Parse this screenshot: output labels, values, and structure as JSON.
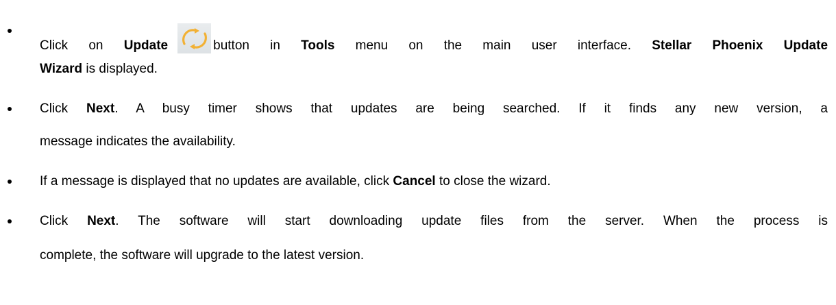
{
  "icons": {
    "update_icon": "update-circular-arrows-icon",
    "bullet_icon": "bullet-dot-icon"
  },
  "colors": {
    "text": "#000000",
    "icon_arrow": "#f2b134",
    "icon_background": "#e3e7ea"
  },
  "steps": [
    {
      "line1": {
        "pre": "Click on ",
        "bold1": "Update",
        "post1": "button in ",
        "bold2": "Tools",
        "post2": " menu on the main user interface. ",
        "bold3": "Stellar Phoenix Update"
      },
      "line2": {
        "bold": "Wizard",
        "post": " is displayed."
      }
    },
    {
      "line1": {
        "pre": "Click ",
        "bold": "Next",
        "post": ". A busy timer shows that updates are being searched. If it finds any new version, a"
      },
      "line2": {
        "text": "message indicates the availability."
      }
    },
    {
      "line1": {
        "pre": "If a message is displayed that no updates are available, click ",
        "bold": "Cancel",
        "post": " to close the wizard."
      }
    },
    {
      "line1": {
        "pre": "Click ",
        "bold": "Next",
        "post": ". The software will start downloading update files from the server. When the process is"
      },
      "line2": {
        "text": "complete, the software will upgrade to the latest version."
      }
    }
  ]
}
